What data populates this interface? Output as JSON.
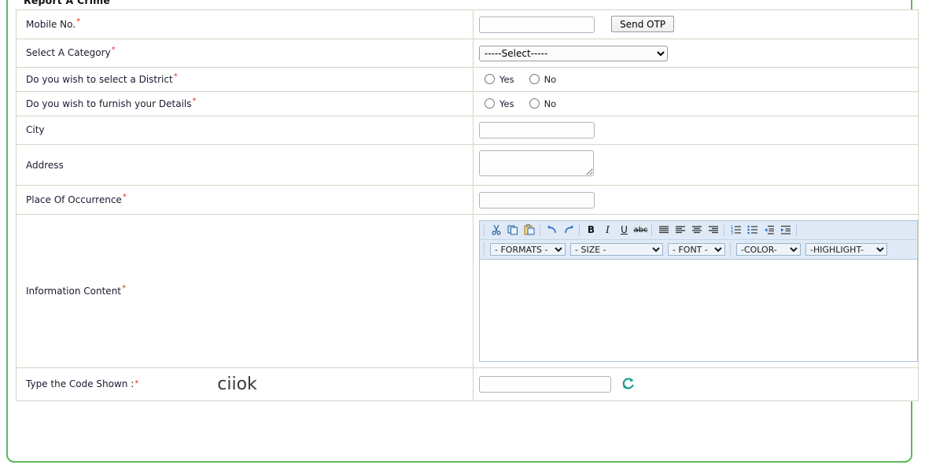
{
  "fieldset": {
    "legend": "Report A Crime"
  },
  "form": {
    "rows": [
      {
        "key": "mobile",
        "label": "Mobile No.",
        "required": true,
        "input_value": "",
        "button_label": "Send OTP"
      },
      {
        "key": "category",
        "label": "Select A Category",
        "required": true,
        "selected_option": "-----Select-----"
      },
      {
        "key": "district",
        "label": "Do you wish to select a District",
        "required": true,
        "options": [
          "Yes",
          "No"
        ]
      },
      {
        "key": "details",
        "label": "Do you wish to furnish your Details",
        "required": true,
        "options": [
          "Yes",
          "No"
        ]
      },
      {
        "key": "city",
        "label": "City",
        "required": false,
        "input_value": ""
      },
      {
        "key": "address",
        "label": "Address",
        "required": false,
        "input_value": ""
      },
      {
        "key": "place",
        "label": "Place Of Occurrence",
        "required": true,
        "input_value": ""
      },
      {
        "key": "content",
        "label": "Information Content",
        "required": true
      },
      {
        "key": "captcha",
        "label": "Type the Code Shown :",
        "required": true,
        "captcha_text": "ciiok",
        "input_value": ""
      }
    ]
  },
  "editor": {
    "toolbar_icons": [
      "cut-icon",
      "copy-icon",
      "paste-icon",
      "undo-icon",
      "redo-icon",
      "bold-icon",
      "italic-icon",
      "underline-icon",
      "strikethrough-icon",
      "align-justify-icon",
      "align-left-icon",
      "align-center-icon",
      "align-right-icon",
      "ordered-list-icon",
      "unordered-list-icon",
      "outdent-icon",
      "indent-icon"
    ],
    "dropdowns": {
      "formats": "- FORMATS -",
      "size": "- SIZE -",
      "font": "- FONT -",
      "color": "-COLOR-",
      "highlight": "-HIGHLIGHT-"
    },
    "body_content": ""
  },
  "icons": {
    "refresh": "refresh-captcha-icon"
  },
  "colors": {
    "fieldset_border": "#5cb85c",
    "cell_border": "#d6d2c4",
    "required_star": "#e0301e",
    "toolbar_bg": "#dfeaf6",
    "editor_border": "#a9c3dd",
    "refresh_icon": "#1a9e8f"
  }
}
